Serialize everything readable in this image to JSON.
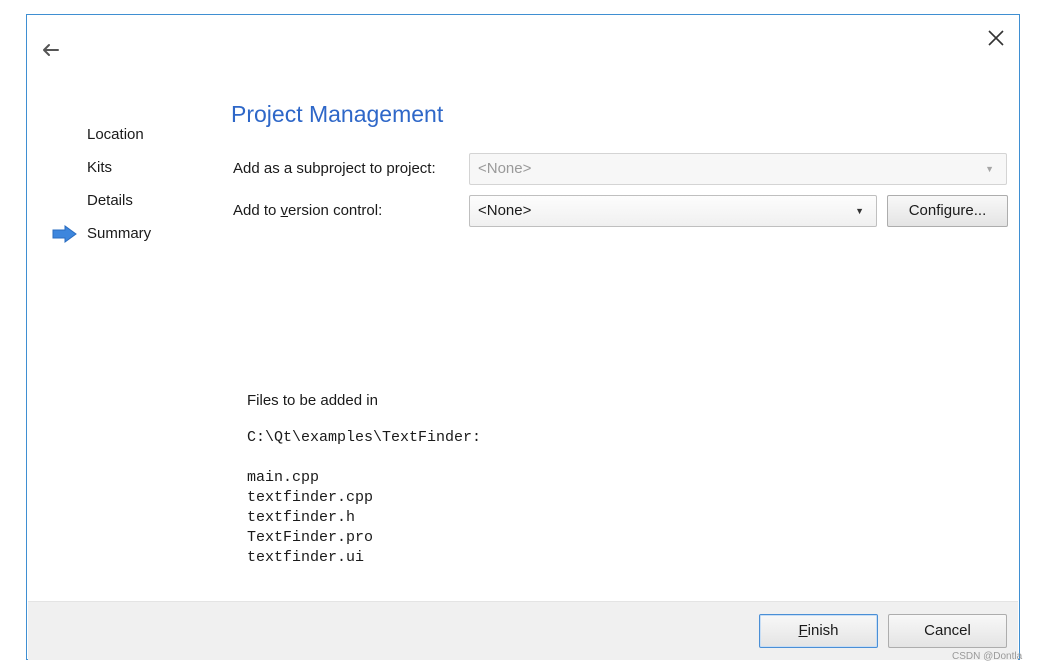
{
  "wizard": {
    "title": "Project Management",
    "steps": [
      {
        "label": "Location",
        "current": false
      },
      {
        "label": "Kits",
        "current": false
      },
      {
        "label": "Details",
        "current": false
      },
      {
        "label": "Summary",
        "current": true
      }
    ],
    "subproject": {
      "label_before": "Add as a subproject to project:",
      "value": "<None>",
      "enabled": false
    },
    "version_control": {
      "label_before": "Add to ",
      "label_mnemonic": "v",
      "label_after": "ersion control:",
      "value": "<None>",
      "configure_label": "Configure..."
    },
    "files": {
      "heading": "Files to be added in",
      "path": "C:\\Qt\\examples\\TextFinder:",
      "items": [
        "main.cpp",
        "textfinder.cpp",
        "textfinder.h",
        "TextFinder.pro",
        "textfinder.ui"
      ]
    },
    "buttons": {
      "finish_mnemonic": "F",
      "finish_rest": "inish",
      "cancel": "Cancel"
    }
  },
  "icons": {
    "back": "back-arrow-icon",
    "close": "close-icon",
    "current_step": "right-arrow-icon",
    "dropdown": "chevron-down-icon"
  },
  "colors": {
    "accent": "#2e67c8",
    "window_border": "#3f8fd2",
    "step_arrow": "#3d86dd",
    "footer_bg": "#f0f0f0"
  },
  "watermark": "CSDN @Dontla"
}
